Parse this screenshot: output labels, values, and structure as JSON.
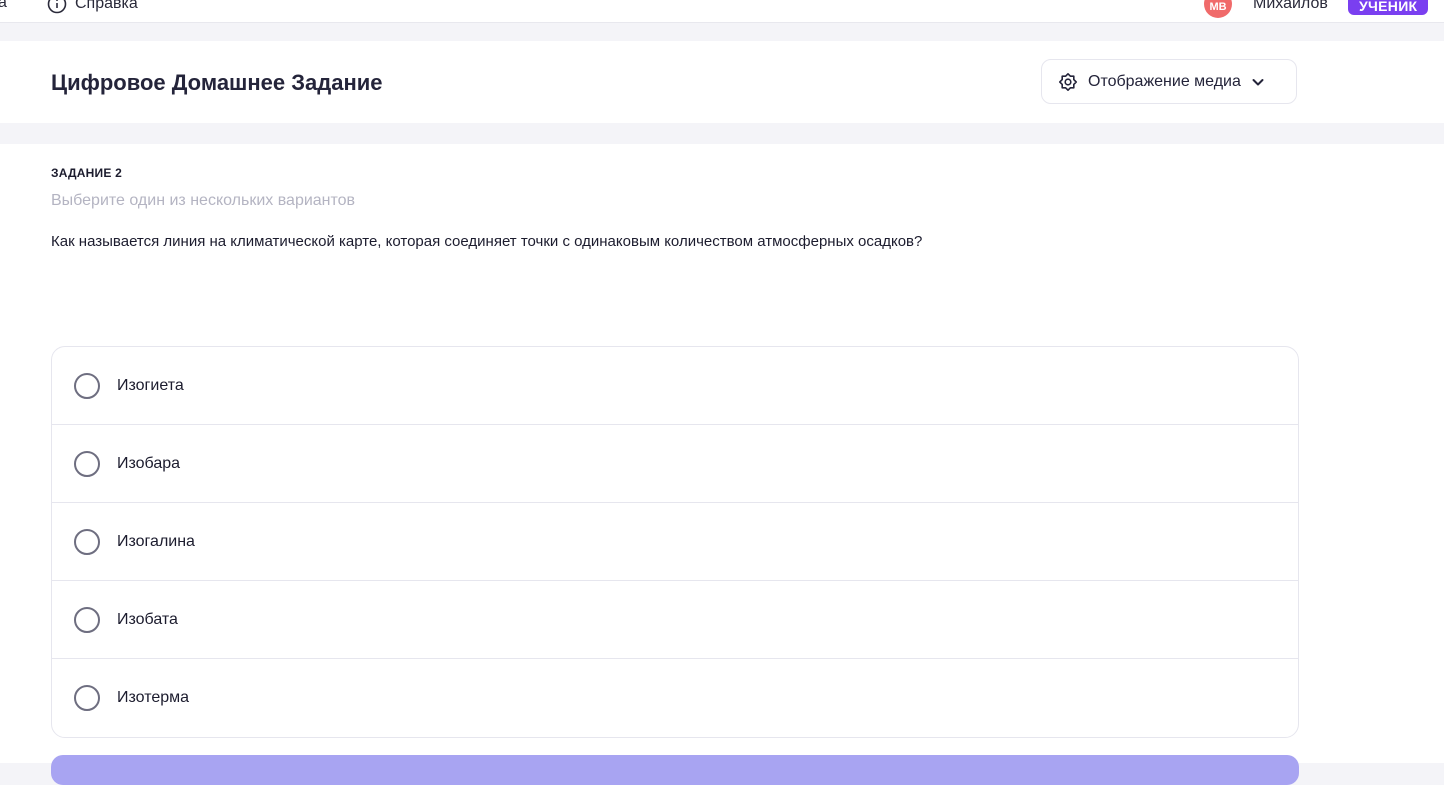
{
  "topbar": {
    "nav_partial_label": "а",
    "help_label": "Справка",
    "avatar_initials": "МВ",
    "user_name": "Михайлов",
    "role_badge": "УЧЕНИК"
  },
  "header": {
    "title": "Цифровое Домашнее Задание",
    "media_toggle_label": "Отображение медиа",
    "media_toggle_icon": "gear-flower-icon",
    "chevron_icon": "chevron-down-icon"
  },
  "task": {
    "label": "ЗАДАНИЕ 2",
    "hint": "Выберите один из нескольких вариантов",
    "question": "Как называется линия на климатической карте, которая соединяет точки с одинаковым количеством атмосферных осадков?",
    "options": [
      {
        "label": "Изогиета"
      },
      {
        "label": "Изобара"
      },
      {
        "label": "Изогалина"
      },
      {
        "label": "Изобата"
      },
      {
        "label": "Изотерма"
      }
    ]
  },
  "colors": {
    "accent": "#7a3ff0",
    "submit_button": "#a8a4f2",
    "avatar": "#f06a6a"
  }
}
